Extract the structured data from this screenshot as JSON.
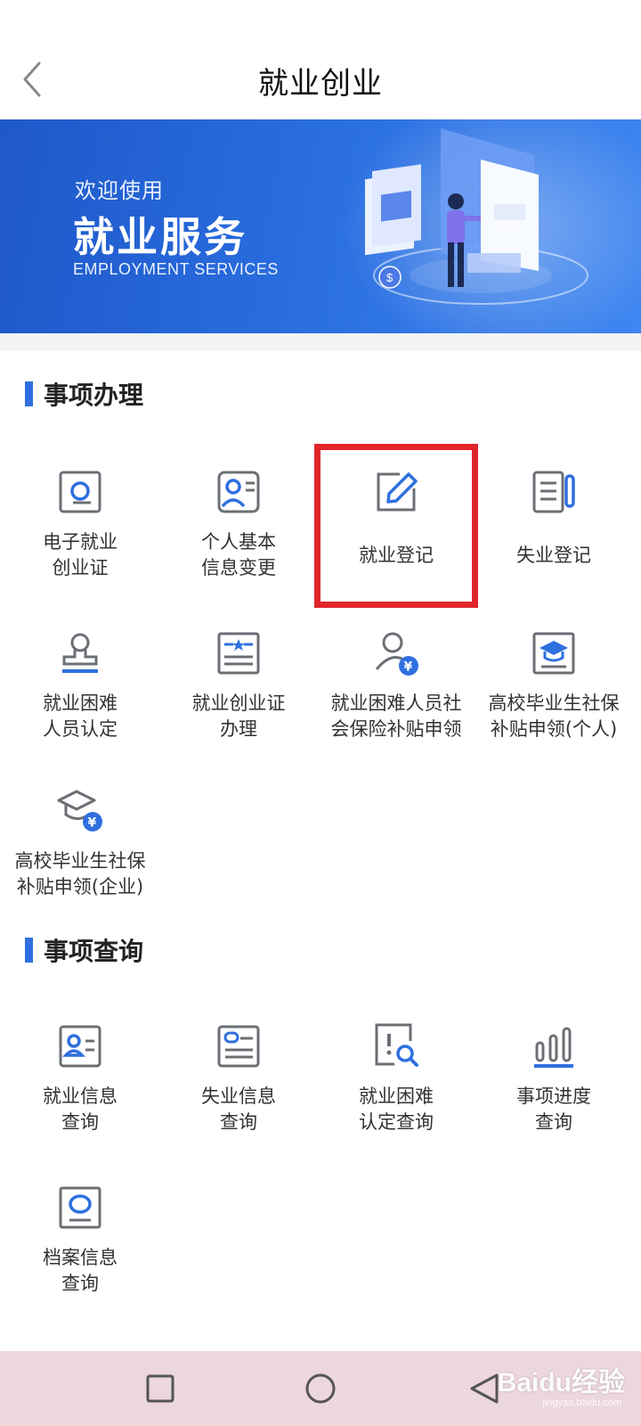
{
  "header": {
    "title": "就业创业",
    "back_icon": "back-chevron-icon"
  },
  "banner": {
    "welcome": "欢迎使用",
    "title": "就业服务",
    "subtitle": "EMPLOYMENT SERVICES"
  },
  "section_handle": {
    "title": "事项办理",
    "items": [
      {
        "label": "电子就业\n创业证",
        "icon": "search-card-icon"
      },
      {
        "label": "个人基本\n信息变更",
        "icon": "person-card-icon"
      },
      {
        "label": "就业登记",
        "icon": "edit-pencil-icon"
      },
      {
        "label": "失业登记",
        "icon": "document-pen-icon"
      },
      {
        "label": "就业困难\n人员认定",
        "icon": "stamp-icon"
      },
      {
        "label": "就业创业证\n办理",
        "icon": "certificate-icon"
      },
      {
        "label": "就业困难人员社\n会保险补贴申领",
        "icon": "person-yuan-icon"
      },
      {
        "label": "高校毕业生社保\n补贴申领(个人)",
        "icon": "graduation-cap-card-icon"
      },
      {
        "label": "高校毕业生社保\n补贴申领(企业)",
        "icon": "graduation-cap-yuan-icon"
      }
    ]
  },
  "section_query": {
    "title": "事项查询",
    "items": [
      {
        "label": "就业信息\n查询",
        "icon": "profile-card-icon"
      },
      {
        "label": "失业信息\n查询",
        "icon": "id-card-icon"
      },
      {
        "label": "就业困难\n认定查询",
        "icon": "alert-search-icon"
      },
      {
        "label": "事项进度\n查询",
        "icon": "bar-progress-icon"
      },
      {
        "label": "档案信息\n查询",
        "icon": "archive-search-icon"
      }
    ]
  },
  "system_nav": {
    "recent_icon": "square-icon",
    "home_icon": "circle-icon",
    "back_icon": "triangle-back-icon"
  },
  "watermark": {
    "logo": "Baidu经验",
    "url": "jingyan.baidu.com"
  },
  "colors": {
    "accent": "#2f6fdf",
    "highlight": "#e0262b",
    "icon_gray": "#6b6f75",
    "icon_blue": "#2f6fdf"
  }
}
